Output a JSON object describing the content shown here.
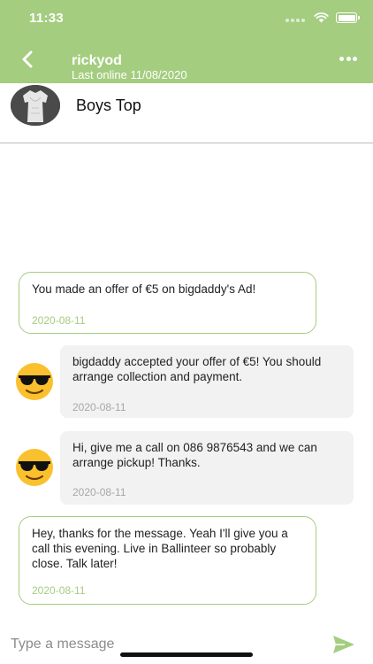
{
  "status_bar": {
    "time": "11:33"
  },
  "header": {
    "user_name": "rickyod",
    "last_online": "Last online 11/08/2020",
    "back_icon": "chevron-left-icon",
    "more_icon": "more-horizontal-icon"
  },
  "item": {
    "title": "Boys Top"
  },
  "messages": [
    {
      "side": "outgoing",
      "text": "You made an offer of €5 on bigdaddy's Ad!",
      "date": "2020-08-11"
    },
    {
      "side": "incoming",
      "text": "bigdaddy accepted your offer of €5! You should arrange collection and payment.",
      "date": "2020-08-11"
    },
    {
      "side": "incoming",
      "text": "Hi, give me a call on 086 9876543 and we can arrange pickup! Thanks.",
      "date": "2020-08-11"
    },
    {
      "side": "outgoing",
      "text": "Hey, thanks for the message. Yeah I'll give you a call this evening. Live in Ballinteer so probably close. Talk later!",
      "date": "2020-08-11"
    }
  ],
  "composer": {
    "placeholder": "Type a message",
    "send_icon": "send-icon"
  },
  "colors": {
    "accent": "#a4cd80",
    "incoming_bubble": "#f2f2f2",
    "outgoing_border": "#a4cd80"
  }
}
